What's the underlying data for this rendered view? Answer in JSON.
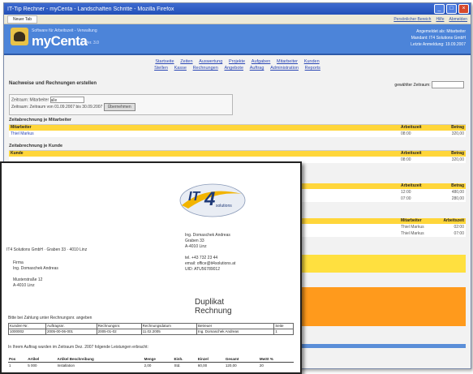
{
  "window": {
    "title": "IT-Tip Rechner - myCenta - Landschaften Schritte - Mozilla Firefox",
    "tab_label": "Neuer Tab",
    "toolbar_links": [
      "Persönlicher Bereich",
      "Hilfe",
      "Abmelden"
    ]
  },
  "header": {
    "brand_sub": "Software für Arbeitszeit - Verwaltung",
    "brand": "myCenta",
    "version": "Ver. 3.0",
    "user_lines": [
      "Angemeldet als: Mitarbeiter",
      "Mandant: IT4 Solutions GmbH",
      "Letzte Anmeldung: 19.09.2007"
    ]
  },
  "nav": {
    "row1": [
      "Startseite",
      "Zeiten",
      "Auswertung",
      "Projekte",
      "Aufgaben",
      "Mitarbeiter",
      "Kunden"
    ],
    "row2": [
      "Stellen",
      "Kasse",
      "Rechnungen",
      "Angebote",
      "Auftrag",
      "Administration",
      "Reports"
    ]
  },
  "filters": {
    "heading": "Nachweise und Rechnungen erstellen",
    "row1_label": "Zeitraum: Mitarbeiter",
    "row1_value": "alle",
    "row2_label": "Zeitraum: Zeitraum",
    "row2_value": "von 01.09.2007 bis 30.09.2007",
    "apply_button": "Übernehmen",
    "right_label": "gewählter Zeitraum:"
  },
  "sections": [
    {
      "title": "Zeitabrechnung je Mitarbeiter",
      "col1": "Mitarbeiter",
      "col2": "Arbeitszeit",
      "col3": "Betrag",
      "rows": [
        {
          "c1": "Thiel Markus",
          "c2": "08:00",
          "c3": "320,00"
        }
      ]
    },
    {
      "title": "Zeitabrechnung je Kunde",
      "col1": "Kunde",
      "col2": "Arbeitszeit",
      "col3": "Betrag",
      "rows": [
        {
          "c1": "",
          "c2": "08:00",
          "c3": "320,00"
        }
      ]
    }
  ],
  "right_rows": [
    {
      "c1": "Arbeitszeit",
      "c2": "Betrag"
    },
    {
      "c1": "12:00",
      "c2": "480,00"
    },
    {
      "c1": "07:00",
      "c2": "280,00"
    },
    {
      "c1": "Mitarbeiter",
      "c2": "Arbeitszeit"
    },
    {
      "c1": "Thiel Markus",
      "c2": "02:00"
    },
    {
      "c1": "Thiel Markus",
      "c2": "07:00"
    }
  ],
  "invoice": {
    "company_line": "IT4 Solutions GmbH · Graben 33 · 4010 Linz",
    "recipient": [
      "Firma",
      "Ing. Domaschek Andreas",
      "",
      "Musterstraße 12",
      "A-4010 Linz"
    ],
    "sender": [
      "Ing. Domaschek Andreas",
      "Graben 33",
      "A-4010 Linz",
      "",
      "tel. +43 732 23 44",
      "email: office@it4solutions.at",
      "UID: ATU56789012"
    ],
    "title_line1": "Duplikat",
    "title_line2": "Rechnung",
    "note": "Bitte bei Zahlung unter Rechnungsnr. angeben",
    "table_header": [
      "Kunden-Nr.",
      "Auftragsnr.",
      "Rechnungsnr.",
      "Rechnungsdatum",
      "Betreuer",
      "Seite"
    ],
    "table_row": [
      "1000002",
      "2005-00-06-001",
      "2005-01-02",
      "11.02.2005",
      "Ing. Domaschek Andreas",
      "1"
    ],
    "intro": "In Ihrem Auftrag wurden im Zeitraum Dez. 2007 folgende Leistungen erbracht:",
    "pos_header": [
      "Pos",
      "Artikel",
      "Artikel Beschreibung",
      "Menge",
      "Einh.",
      "Einzel",
      "Gesamt",
      "MwSt %"
    ],
    "pos_rows": [
      [
        "1",
        "5 000",
        "Installation",
        "2,00",
        "Std.",
        "60,00",
        "120,00",
        "20"
      ]
    ]
  }
}
